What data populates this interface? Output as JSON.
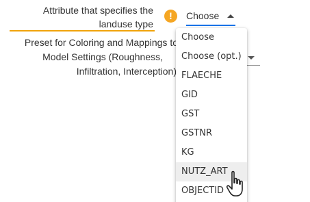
{
  "landuse_field": {
    "label_line1": "Attribute that specifies the",
    "label_line2": "landuse type",
    "selected_value": "Choose"
  },
  "preset_field": {
    "label_line1": "Preset for Coloring and Mappings to",
    "label_line2": "Model Settings (Roughness,",
    "label_line3": "Infiltration, Interception)"
  },
  "dropdown": {
    "options": [
      "Choose",
      "Choose (opt.)",
      "FLAECHE",
      "GID",
      "GST",
      "GSTNR",
      "KG",
      "NUTZ_ART",
      "OBJECTID"
    ],
    "hovered_option": "NUTZ_ART"
  },
  "colors": {
    "warning": "#f5a623",
    "accent_underline": "#f0a30a",
    "focus": "#1a73e8"
  },
  "icons": {
    "warning": "exclamation-icon",
    "cursor": "hand-pointer-icon"
  }
}
